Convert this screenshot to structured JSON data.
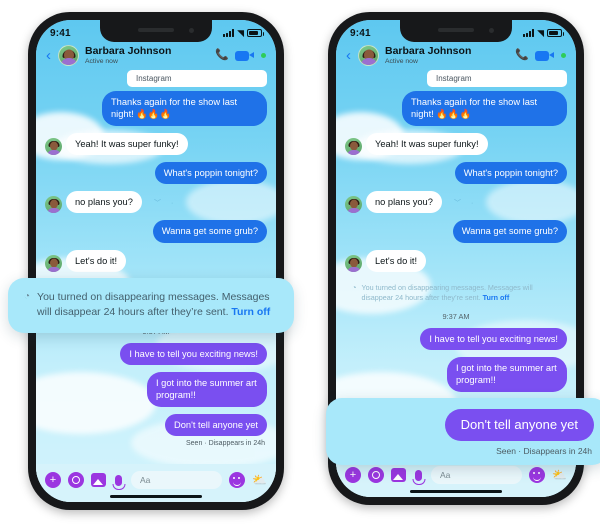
{
  "phones": {
    "left": {
      "status_bar": {
        "time": "9:41",
        "signal_icon": "signal-bars-icon",
        "wifi_icon": "wifi-icon",
        "battery_icon": "battery-icon"
      },
      "header": {
        "back_icon": "back-chevron-icon",
        "avatar": "contact-avatar",
        "name": "Barbara Johnson",
        "presence": "Active now",
        "call_icon": "phone-call-icon",
        "video_icon": "video-call-icon",
        "active_dot": "active-status-dot"
      },
      "source_label": "Instagram",
      "messages": [
        {
          "id": "m1",
          "side": "me",
          "style": "blue",
          "text": "Thanks again for the show last night! 🔥🔥🔥"
        },
        {
          "id": "m2",
          "side": "them",
          "style": "them",
          "text": "Yeah! It was super funky!"
        },
        {
          "id": "m3",
          "side": "me",
          "style": "blue",
          "text": "What's poppin tonight?"
        },
        {
          "id": "m4",
          "side": "them",
          "style": "them",
          "text": "no plans you?"
        },
        {
          "id": "m5",
          "side": "me",
          "style": "blue",
          "text": "Wanna get some grub?"
        },
        {
          "id": "m6",
          "side": "them",
          "style": "them",
          "text": "Let's do it!"
        }
      ],
      "timestamp": "9:37 AM",
      "messages_after": [
        {
          "id": "m7",
          "side": "me",
          "style": "purple",
          "text": "I have to tell you exciting news!"
        },
        {
          "id": "m8",
          "side": "me",
          "style": "purple",
          "text": "I got into the summer art program!!"
        },
        {
          "id": "m9",
          "side": "me",
          "style": "purple",
          "text": "Don't tell anyone yet"
        }
      ],
      "receipt": "Seen · Disappears in 24h",
      "composer": {
        "add_icon": "plus-circle-icon",
        "camera_icon": "camera-icon",
        "gallery_icon": "gallery-icon",
        "mic_icon": "microphone-icon",
        "input_placeholder": "Aa",
        "emoji_icon": "smiley-icon",
        "sticker_icon": "sticker-icon",
        "home_indicator": "home-indicator"
      }
    },
    "right": {
      "status_bar": {
        "time": "9:41"
      },
      "header": {
        "name": "Barbara Johnson",
        "presence": "Active now"
      },
      "source_label": "Instagram",
      "timestamp": "9:37 AM",
      "receipt": "Seen · Disappears in 24h"
    }
  },
  "callouts": {
    "disappearing_banner": {
      "clock_icon": "disappearing-clock-icon",
      "text": "You turned on disappearing messages. Messages will disappear 24 hours after they’re sent.",
      "action_label": "Turn off"
    },
    "highlighted_message": {
      "text": "Don't tell anyone yet",
      "receipt": "Seen · Disappears in 24h"
    }
  },
  "colors": {
    "blue_bubble": "#1f72e8",
    "purple_bubble": "#7a4ff0",
    "white_bubble": "#ffffff",
    "accent_link": "#1877f2",
    "callout_bg": "#a8e8fa",
    "composer_icon": "#9b36e0"
  }
}
